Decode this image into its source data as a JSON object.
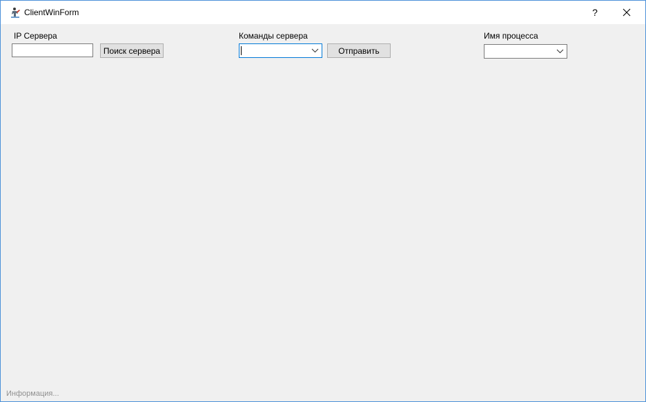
{
  "window": {
    "title": "ClientWinForm",
    "help_label": "?",
    "accent": "#0078d7"
  },
  "icons": {
    "app": "app-icon",
    "help": "help-icon",
    "close": "close-icon",
    "dropdown": "chevron-down-icon"
  },
  "server_ip": {
    "label": "IP Сервера",
    "value": "",
    "search_button": "Поиск сервера"
  },
  "commands": {
    "label": "Команды сервера",
    "value": "",
    "send_button": "Отправить"
  },
  "process": {
    "label": "Имя процесса",
    "value": ""
  },
  "status": {
    "text": "Информация..."
  }
}
